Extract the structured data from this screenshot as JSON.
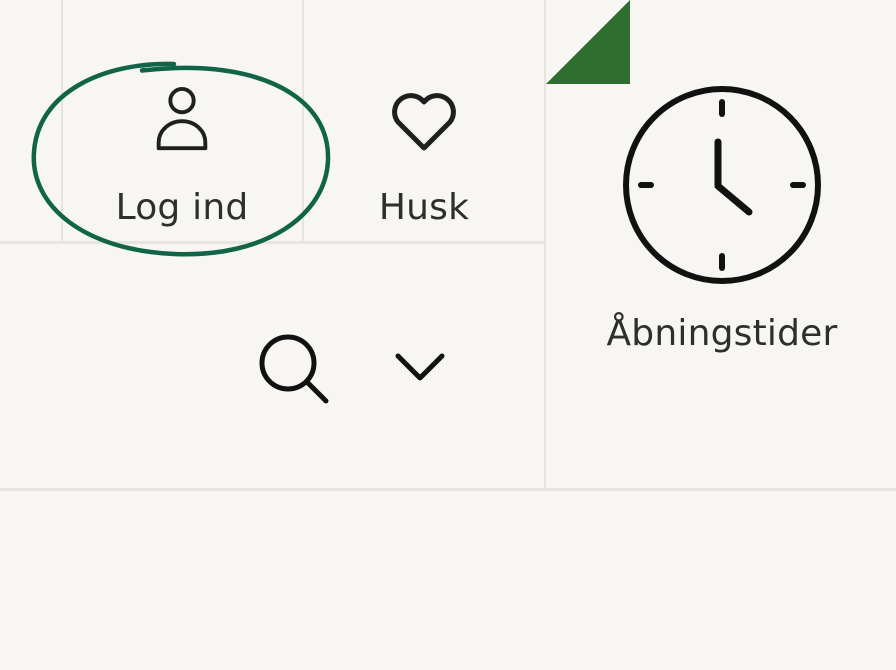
{
  "header": {
    "login_label": "Log ind",
    "favorites_label": "Husk",
    "opening_hours_label": "Åbningstider"
  },
  "icons": {
    "login": "user-icon",
    "favorites": "heart-icon",
    "opening_hours": "clock-icon",
    "search": "search-icon",
    "menu": "chevron-down-icon"
  },
  "colors": {
    "accent_green": "#2e6e30",
    "annotation_green": "#116448",
    "background": "#f7f6f2"
  }
}
